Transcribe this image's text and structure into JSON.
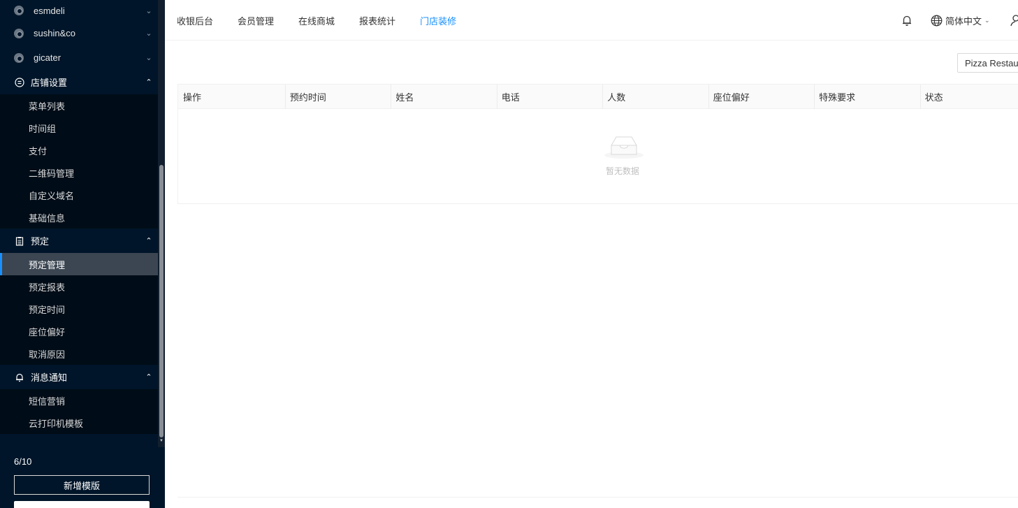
{
  "sidebar": {
    "stores": [
      {
        "label": "esmdeli"
      },
      {
        "label": "sushin&co"
      },
      {
        "label": "gicater"
      }
    ],
    "groups": [
      {
        "label": "店铺设置",
        "items": [
          "菜单列表",
          "时间组",
          "支付",
          "二维码管理",
          "自定义域名",
          "基础信息"
        ]
      },
      {
        "label": "预定",
        "items": [
          "预定管理",
          "预定报表",
          "预定时间",
          "座位偏好",
          "取消原因"
        ]
      },
      {
        "label": "消息通知",
        "items": [
          "短信营销",
          "云打印机模板"
        ]
      }
    ],
    "active_item": "预定管理",
    "counter": "6/10",
    "new_template_label": "新增模版"
  },
  "header": {
    "nav": [
      "收银后台",
      "会员管理",
      "在线商城",
      "报表统计",
      "门店装修"
    ],
    "active_nav": "门店装修",
    "language": "简体中文"
  },
  "content": {
    "store_select_value": "Pizza Restaurant",
    "table": {
      "columns": [
        "操作",
        "预约时间",
        "姓名",
        "电话",
        "人数",
        "座位偏好",
        "特殊要求",
        "状态"
      ],
      "empty_text": "暂无数据"
    }
  },
  "colors": {
    "sidebar_bg": "#001529",
    "submenu_bg": "#000c17",
    "accent": "#1890ff"
  },
  "icons": [
    "chrome-icon",
    "settings-icon",
    "clipboard-icon",
    "bell-icon",
    "globe-icon",
    "user-icon",
    "empty-inbox-icon"
  ]
}
